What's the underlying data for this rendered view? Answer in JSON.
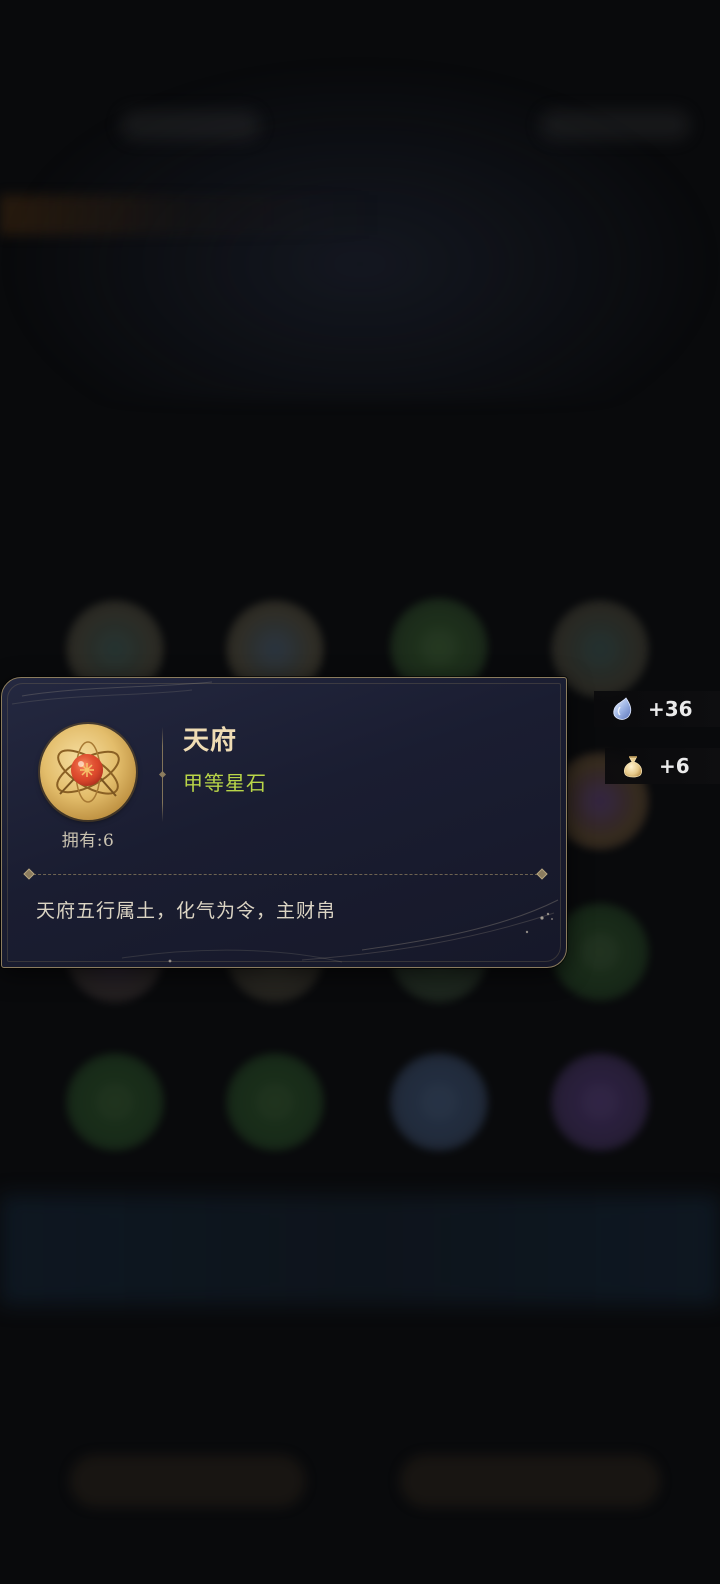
{
  "item": {
    "name": "天府",
    "grade": "甲等星石",
    "owned": "拥有:6",
    "description": "天府五行属土，化气为令，主财帛",
    "icon": "star-stone-gem-icon"
  },
  "resources": [
    {
      "icon": "spirit-drop-icon",
      "value": "+36"
    },
    {
      "icon": "coin-pouch-icon",
      "value": "+6"
    }
  ],
  "colors": {
    "card_bg": "#1c1f33",
    "card_border": "#8b7c5e",
    "name": "#efdcb4",
    "grade": "#b9d548",
    "text": "#dcd5c4"
  }
}
